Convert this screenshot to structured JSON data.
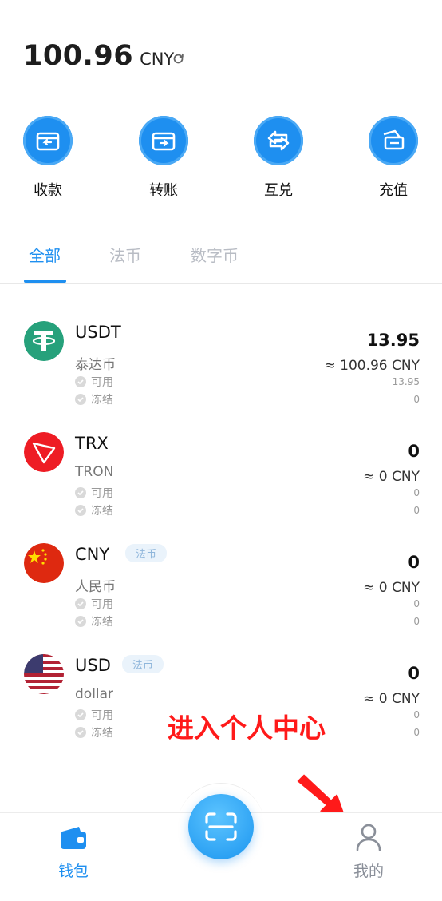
{
  "balance": {
    "amount": "100.96",
    "unit": "CNY",
    "refresh_icon": "refresh-icon"
  },
  "actions": [
    {
      "label": "收款",
      "icon": "receive-icon"
    },
    {
      "label": "转账",
      "icon": "transfer-icon"
    },
    {
      "label": "互兑",
      "icon": "exchange-icon"
    },
    {
      "label": "充值",
      "icon": "recharge-icon"
    }
  ],
  "tabs": [
    {
      "label": "全部",
      "active": true
    },
    {
      "label": "法币",
      "active": false
    },
    {
      "label": "数字币",
      "active": false
    }
  ],
  "assets": [
    {
      "symbol": "USDT",
      "name": "泰达币",
      "badge": "",
      "balance": "13.95",
      "cny": "≈ 100.96 CNY",
      "available_label": "可用",
      "frozen_label": "冻结",
      "available": "13.95",
      "frozen": "0"
    },
    {
      "symbol": "TRX",
      "name": "TRON",
      "badge": "",
      "balance": "0",
      "cny": "≈ 0 CNY",
      "available_label": "可用",
      "frozen_label": "冻结",
      "available": "0",
      "frozen": "0"
    },
    {
      "symbol": "CNY",
      "name": "人民币",
      "badge": "法币",
      "balance": "0",
      "cny": "≈ 0 CNY",
      "available_label": "可用",
      "frozen_label": "冻结",
      "available": "0",
      "frozen": "0"
    },
    {
      "symbol": "USD",
      "name": "dollar",
      "badge": "法币",
      "balance": "0",
      "cny": "≈ 0 CNY",
      "available_label": "可用",
      "frozen_label": "冻结",
      "available": "0",
      "frozen": "0"
    }
  ],
  "annotation": {
    "text": "进入个人中心"
  },
  "nav": {
    "wallet_label": "钱包",
    "profile_label": "我的",
    "wallet_icon": "wallet-icon",
    "scan_icon": "scan-icon",
    "profile_icon": "person-icon"
  },
  "colors": {
    "accent": "#1e8ff0",
    "annotation": "#ff1a1a",
    "inactive": "#b8bcc4"
  }
}
